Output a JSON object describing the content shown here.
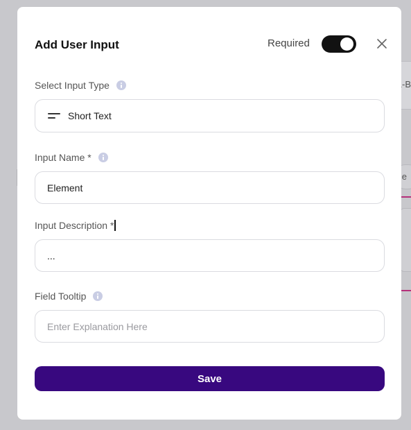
{
  "modal": {
    "title": "Add User Input",
    "required_label": "Required",
    "required_on": true
  },
  "fields": {
    "input_type": {
      "label": "Select Input Type",
      "value": "Short Text",
      "icon": "short-text-icon"
    },
    "input_name": {
      "label": "Input Name *",
      "value": "Element"
    },
    "input_description": {
      "label": "Input Description *",
      "value": "..."
    },
    "field_tooltip": {
      "label": "Field Tooltip",
      "value": "",
      "placeholder": "Enter Explanation Here"
    }
  },
  "actions": {
    "save_label": "Save"
  },
  "background": {
    "card_text": "L-B",
    "pill_text": "e"
  },
  "colors": {
    "accent": "#38087f",
    "toggle_on": "#121212",
    "info_icon": "#c9cde4",
    "border": "#dadbe0",
    "bg_accent_line": "#b5307a"
  }
}
